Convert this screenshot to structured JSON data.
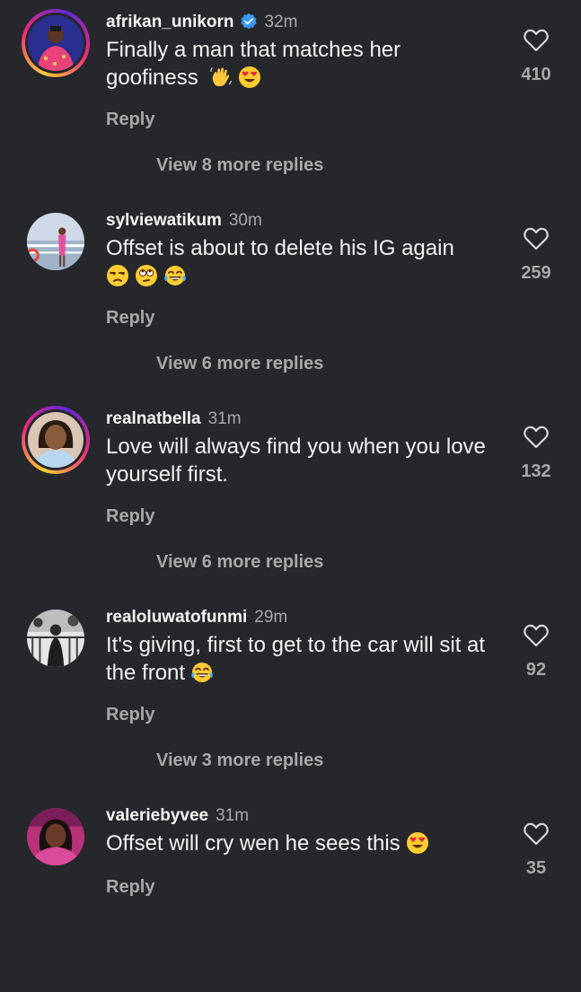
{
  "comments": [
    {
      "username": "afrikan_unikorn",
      "verified": true,
      "time": "32m",
      "text": "Finally a man that matches her goofiness",
      "emojis": [
        "waving-hand",
        "heart-eyes"
      ],
      "reply_label": "Reply",
      "view_more": "View 8 more replies",
      "likes": "410"
    },
    {
      "username": "sylviewatikum",
      "verified": false,
      "time": "30m",
      "text": "Offset is about to delete his IG again",
      "emojis": [
        "unamused",
        "eye-roll",
        "tears-of-joy"
      ],
      "reply_label": "Reply",
      "view_more": "View 6 more replies",
      "likes": "259"
    },
    {
      "username": "realnatbella",
      "verified": false,
      "time": "31m",
      "text": "Love will always find you when you love yourself first.",
      "emojis": [],
      "reply_label": "Reply",
      "view_more": "View 6 more replies",
      "likes": "132"
    },
    {
      "username": "realoluwatofunmi",
      "verified": false,
      "time": "29m",
      "text": "It's giving, first to get to the car will sit at the front",
      "emojis": [
        "tears-of-joy"
      ],
      "reply_label": "Reply",
      "view_more": "View 3 more replies",
      "likes": "92"
    },
    {
      "username": "valeriebyvee",
      "verified": false,
      "time": "31m",
      "text": "Offset will cry wen he sees this",
      "emojis": [
        "heart-eyes"
      ],
      "reply_label": "Reply",
      "likes": "35"
    }
  ],
  "colors": {
    "background": "#25272b",
    "muted": "#a8a8a8",
    "verified": "#3897f0"
  }
}
